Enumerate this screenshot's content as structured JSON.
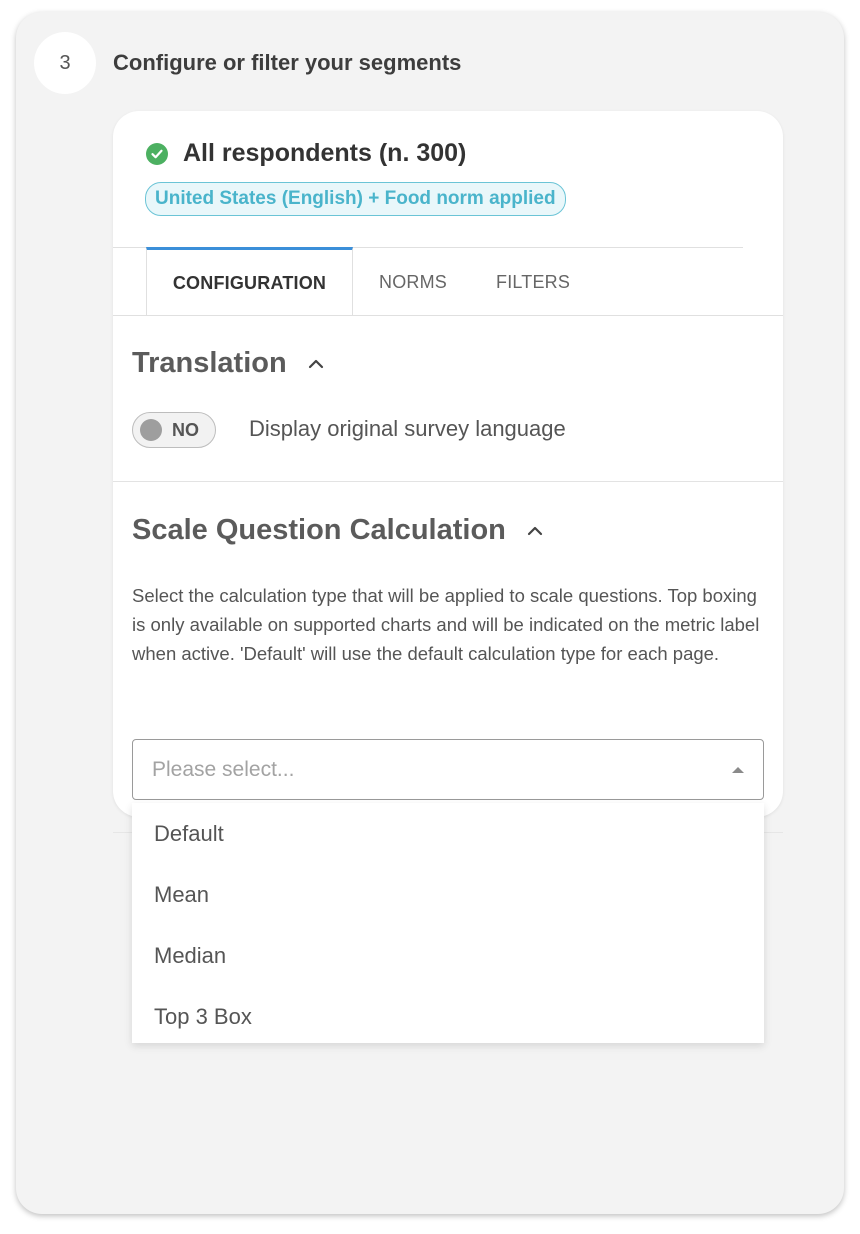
{
  "step": {
    "number": "3",
    "title": "Configure or filter your segments"
  },
  "segment": {
    "title": "All respondents (n. 300)",
    "badge": "United States (English) + Food norm applied",
    "status_icon": "check-circle-icon"
  },
  "tabs": [
    {
      "label": "CONFIGURATION",
      "active": true
    },
    {
      "label": "NORMS",
      "active": false
    },
    {
      "label": "FILTERS",
      "active": false
    }
  ],
  "translation": {
    "title": "Translation",
    "toggle_state": "NO",
    "toggle_description": "Display original survey language"
  },
  "scale": {
    "title": "Scale Question Calculation",
    "description": "Select the calculation type that will be applied to scale questions. Top boxing is only available on supported charts and will be indicated on the metric label when active. 'Default' will use the default calculation type for each page.",
    "select_placeholder": "Please select...",
    "options": [
      "Default",
      "Mean",
      "Median",
      "Top 3 Box"
    ]
  },
  "colors": {
    "accent": "#3b8fd9",
    "success": "#4cb061",
    "badge_text": "#4ab4cb"
  }
}
